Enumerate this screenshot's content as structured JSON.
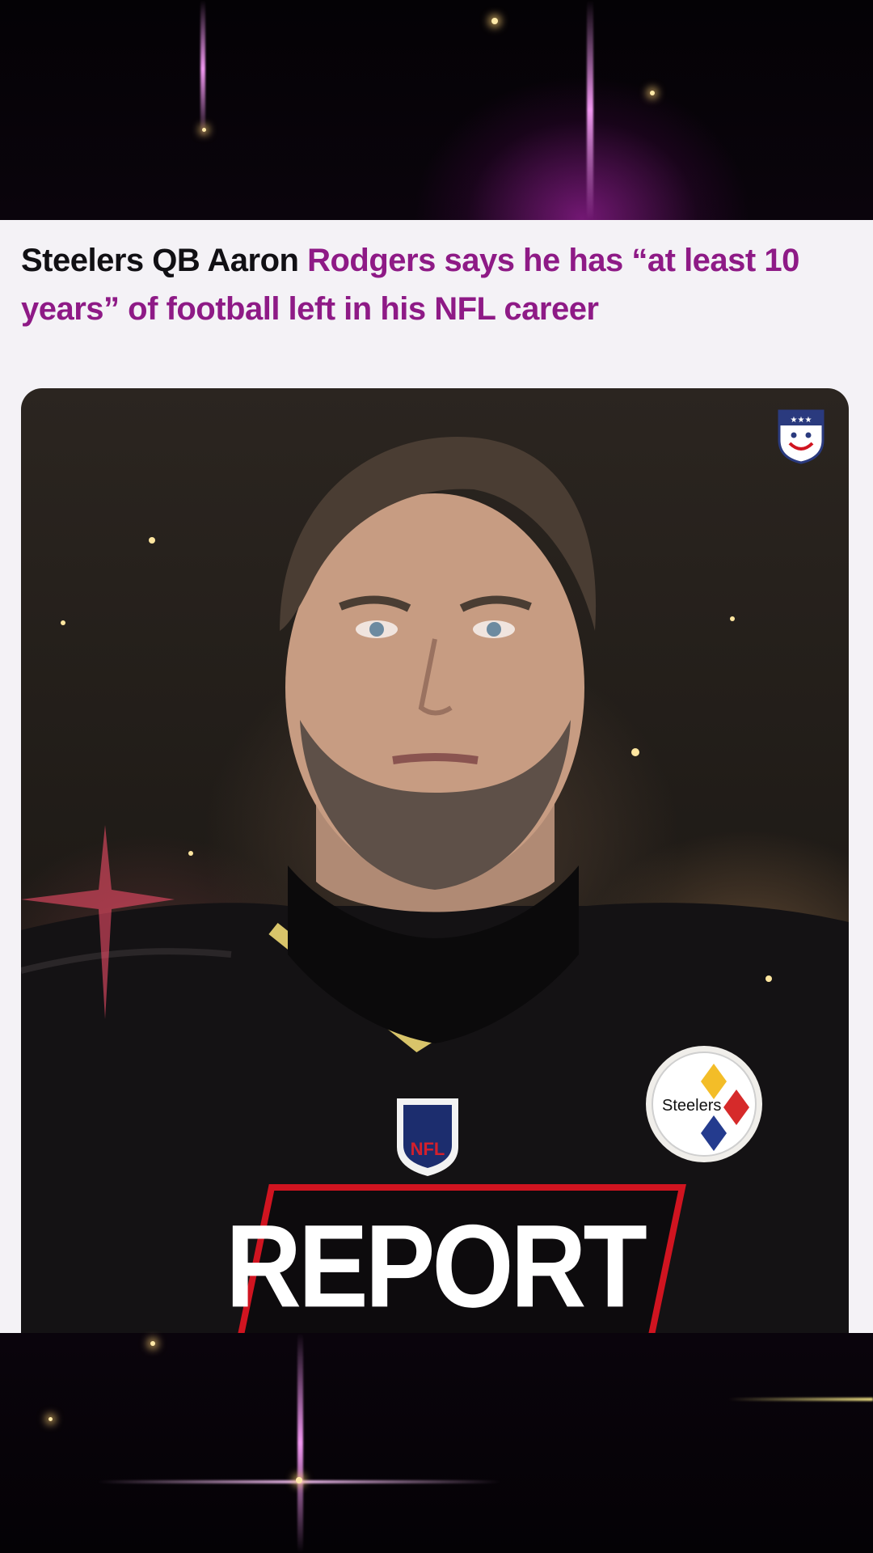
{
  "post": {
    "headline_part1": "Steelers QB Aaron ",
    "headline_part2": "Rodgers says he has “at least 10 years” of football left in his NFL career",
    "photo": {
      "description_icon": "portrait-photo",
      "overlay_label": "REPORT",
      "badge_icon": "smiley-shield-icon",
      "team_logo_text": "Steelers",
      "league_logo_text": "NFL"
    }
  },
  "colors": {
    "accent": "#8e1a86",
    "report_frame": "#d01420",
    "card_background": "#f4f2f6",
    "headline_text": "#111014"
  }
}
